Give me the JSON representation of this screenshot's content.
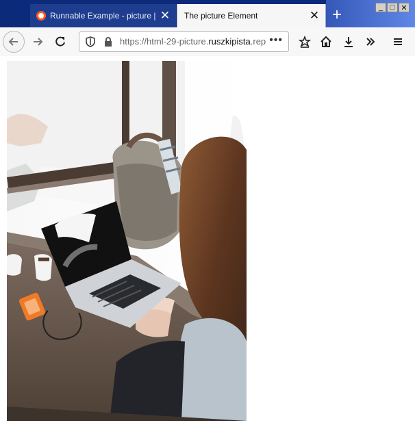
{
  "browser": {
    "tabs": [
      {
        "title": "Runnable Example - picture | Me",
        "close_icon": "close-icon",
        "favicon": "firefox-icon"
      },
      {
        "title": "The picture Element",
        "close_icon": "close-icon"
      }
    ],
    "new_tab_icon": "plus-icon",
    "window_controls": [
      "minimize-icon",
      "maximize-icon",
      "close-icon"
    ],
    "url": {
      "prefix": "https://html-29-picture.",
      "domain": "ruszkipista",
      "suffix": ".rep"
    },
    "url_more": "•••",
    "toolbar_icons": [
      "back-icon",
      "forward-icon",
      "reload-icon",
      "shield-icon",
      "lock-icon",
      "bookmark-star-icon",
      "home-icon",
      "download-icon",
      "overflow-icon",
      "menu-icon"
    ]
  },
  "page": {
    "image_alt": "Woman typing on a laptop beside a window",
    "colors": {
      "window_wood": "#4a3b33",
      "laptop": "#cfd2d6",
      "jacket": "#b8c3cc",
      "hair": "#6c4328",
      "desk": "#6a5b50",
      "orange_drive": "#f07a27"
    }
  }
}
